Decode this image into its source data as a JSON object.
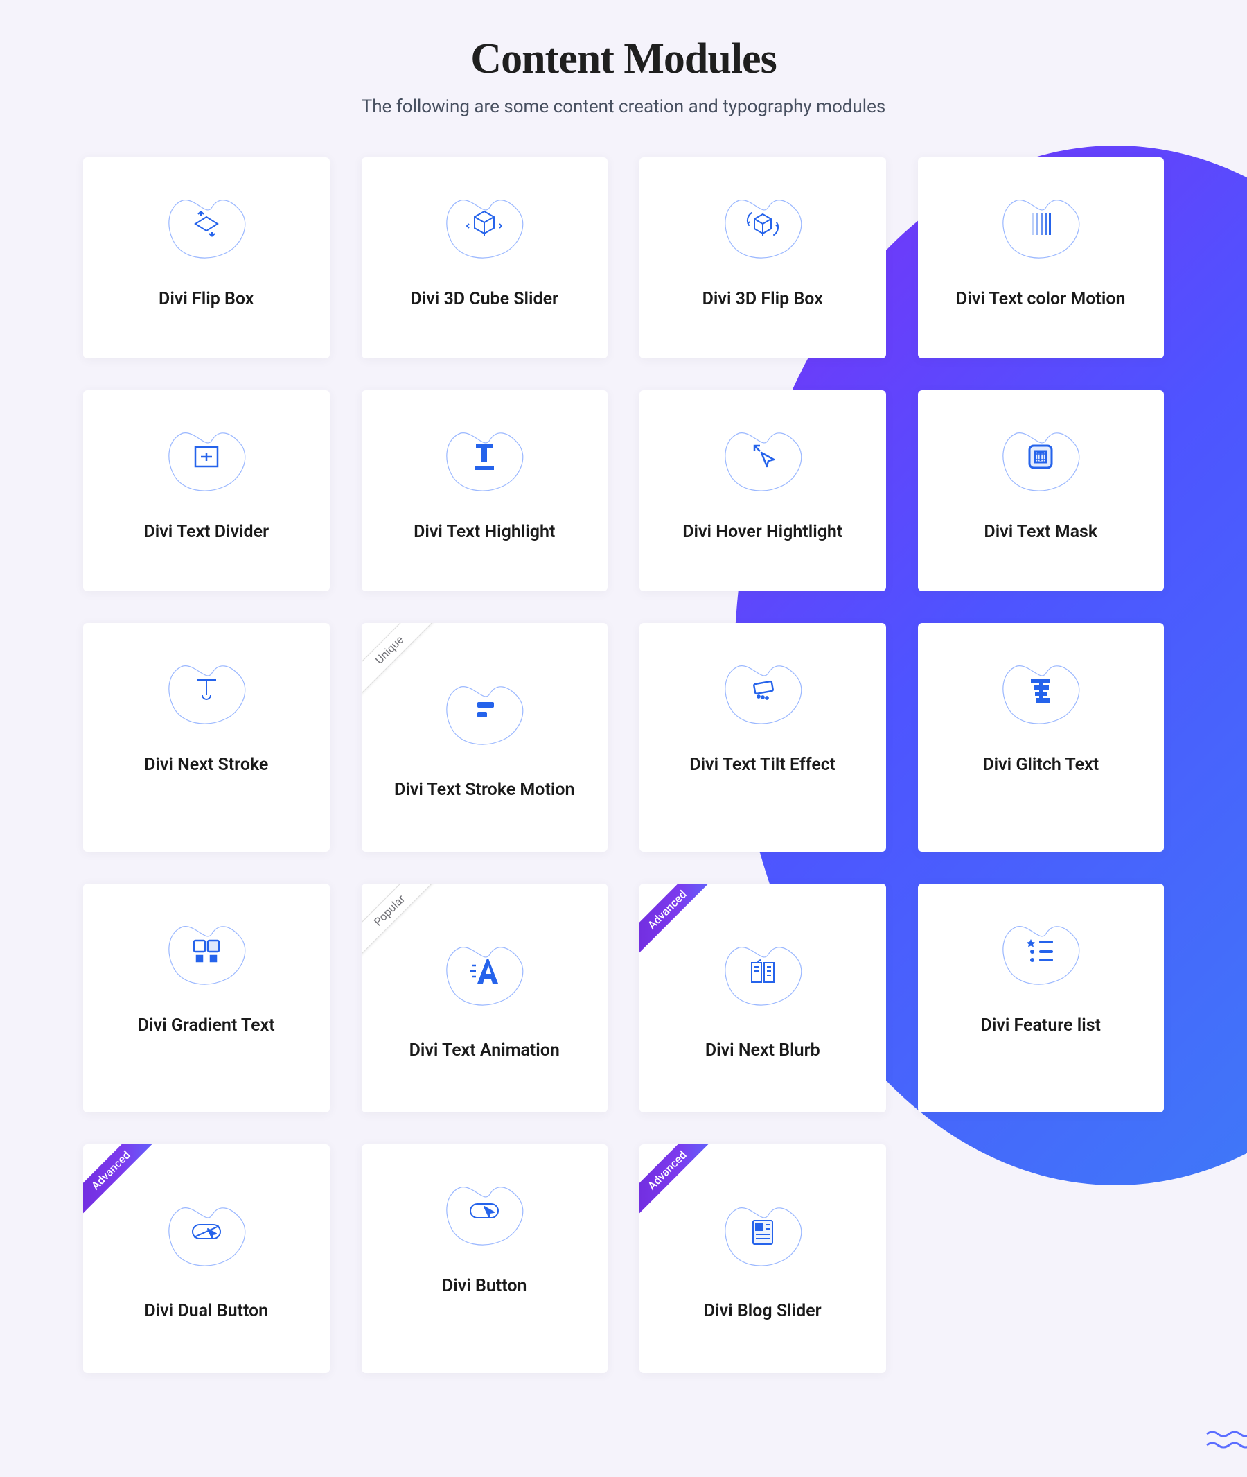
{
  "header": {
    "title": "Content Modules",
    "subtitle": "The following are some content creation and typography modules"
  },
  "ribbons": {
    "unique": "Unique",
    "popular": "Popular",
    "advanced": "Advanced"
  },
  "cards": [
    {
      "title": "Divi Flip Box",
      "icon": "flip-box",
      "ribbon": null
    },
    {
      "title": "Divi 3D Cube Slider",
      "icon": "cube-slider",
      "ribbon": null
    },
    {
      "title": "Divi 3D Flip Box",
      "icon": "cube-flip",
      "ribbon": null
    },
    {
      "title": "Divi Text color Motion",
      "icon": "text-color",
      "ribbon": null
    },
    {
      "title": "Divi Text Divider",
      "icon": "divider",
      "ribbon": null
    },
    {
      "title": "Divi Text Highlight",
      "icon": "highlight",
      "ribbon": null
    },
    {
      "title": "Divi Hover Hightlight",
      "icon": "hover-arrow",
      "ribbon": null
    },
    {
      "title": "Divi Text Mask",
      "icon": "mask",
      "ribbon": null
    },
    {
      "title": "Divi Next Stroke",
      "icon": "stroke",
      "ribbon": null
    },
    {
      "title": "Divi Text Stroke Motion",
      "icon": "stroke-motion",
      "ribbon": "unique"
    },
    {
      "title": "Divi Text Tilt Effect",
      "icon": "tilt",
      "ribbon": null
    },
    {
      "title": "Divi Glitch Text",
      "icon": "glitch",
      "ribbon": null
    },
    {
      "title": "Divi Gradient Text",
      "icon": "gradient",
      "ribbon": null
    },
    {
      "title": "Divi Text Animation",
      "icon": "animation",
      "ribbon": "popular"
    },
    {
      "title": "Divi Next Blurb",
      "icon": "blurb",
      "ribbon": "advanced"
    },
    {
      "title": "Divi Feature list",
      "icon": "feature-list",
      "ribbon": null
    },
    {
      "title": "Divi Dual Button",
      "icon": "dual-button",
      "ribbon": "advanced"
    },
    {
      "title": "Divi Button",
      "icon": "button",
      "ribbon": null
    },
    {
      "title": "Divi Blog Slider",
      "icon": "blog",
      "ribbon": "advanced"
    }
  ],
  "colors": {
    "accent": "#2563eb",
    "stroke": "#93b4ff"
  }
}
